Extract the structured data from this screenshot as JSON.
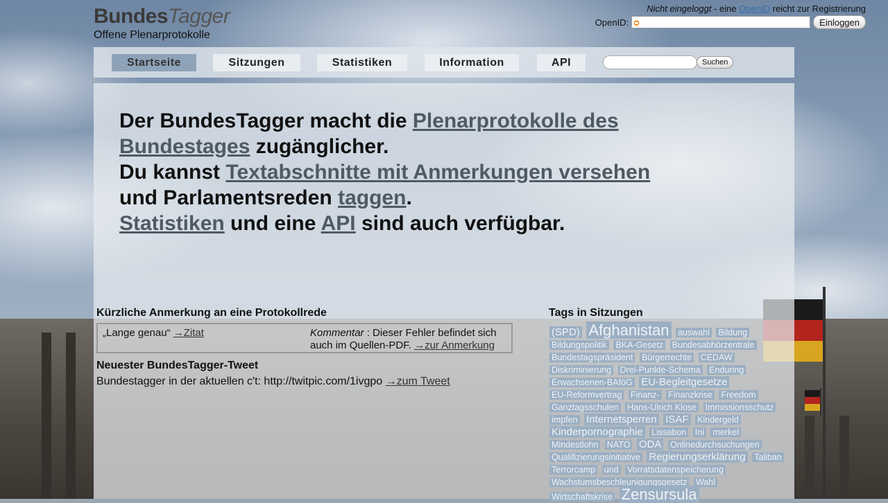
{
  "header": {
    "brand_bold": "Bundes",
    "brand_italic": "Tagger",
    "brand_subtitle": "Offene Plenarprotokolle",
    "login_status_italic": "Nicht eingeloggt",
    "login_status_mid": " - eine ",
    "login_openid_link": "OpenID",
    "login_status_end": " reicht zur Registrierung",
    "openid_label": "OpenID:",
    "openid_value": "",
    "login_button": "Einloggen"
  },
  "nav": {
    "tabs": [
      {
        "label": "Startseite",
        "active": true
      },
      {
        "label": "Sitzungen",
        "active": false
      },
      {
        "label": "Statistiken",
        "active": false
      },
      {
        "label": "Information",
        "active": false
      },
      {
        "label": "API",
        "active": false
      }
    ],
    "search_value": "",
    "search_button": "Suchen"
  },
  "intro": {
    "p1": "Der BundesTagger macht die ",
    "link1": "Plenarprotokolle des Bundestages",
    "p2": " zugänglicher.",
    "p3": "Du kannst ",
    "link2": "Textabschnitte mit Anmerkungen versehen",
    "p4": " und Parlamentsreden ",
    "link3": "taggen",
    "p5": ".",
    "link4": "Statistiken",
    "p6": " und eine ",
    "link5": "API",
    "p7": " sind auch verfügbar."
  },
  "annotation": {
    "heading": "Kürzliche Anmerkung an eine Protokollrede",
    "quote": "„Lange genau“ ",
    "quote_link": "→Zitat",
    "comment_label": "Kommentar",
    "comment_text": " : Dieser Fehler befindet sich auch im Quellen-PDF. ",
    "comment_link": "→zur Anmerkung"
  },
  "tweet": {
    "heading": "Neuester BundesTagger-Tweet",
    "text": "Bundestagger in der aktuellen c't: http://twitpic.com/1ivgpo ",
    "link": "→zum Tweet"
  },
  "tags": {
    "heading": "Tags in Sitzungen",
    "items": [
      {
        "label": "(SPD)",
        "size": "l"
      },
      {
        "label": "Afghanistan",
        "size": "xl"
      },
      {
        "label": "auswahl",
        "size": "s"
      },
      {
        "label": "Bildung",
        "size": "s"
      },
      {
        "label": "Bildungspolitik",
        "size": "s"
      },
      {
        "label": "BKA-Gesetz",
        "size": "s"
      },
      {
        "label": "Bundesabhörzentrale",
        "size": "s"
      },
      {
        "label": "Bundestagspräsident",
        "size": "s"
      },
      {
        "label": "Bürgerrechte",
        "size": "s"
      },
      {
        "label": "CEDAW",
        "size": "s"
      },
      {
        "label": "Diskriminierung",
        "size": "s"
      },
      {
        "label": "Drei-Punkte-Schema",
        "size": "s"
      },
      {
        "label": "Enduring",
        "size": "s"
      },
      {
        "label": "Erwachsenen-BAföG",
        "size": "s"
      },
      {
        "label": "EU-Begleitgesetze",
        "size": "l"
      },
      {
        "label": "EU-Reformvertrag",
        "size": "s"
      },
      {
        "label": "Finanz-",
        "size": "s"
      },
      {
        "label": "Finanzkrise",
        "size": "s"
      },
      {
        "label": "Freedom",
        "size": "s"
      },
      {
        "label": "Ganztagsschulen",
        "size": "s"
      },
      {
        "label": "Hans-Ulrich Klose",
        "size": "s"
      },
      {
        "label": "Immissionsschutz",
        "size": "s"
      },
      {
        "label": "impfen",
        "size": "s"
      },
      {
        "label": "Internetsperren",
        "size": "l"
      },
      {
        "label": "ISAF",
        "size": "l"
      },
      {
        "label": "Kindergeld",
        "size": "s"
      },
      {
        "label": "Kinderpornographie",
        "size": "l"
      },
      {
        "label": "Lissabon",
        "size": "s"
      },
      {
        "label": "Ini",
        "size": "s"
      },
      {
        "label": "merkel",
        "size": "s"
      },
      {
        "label": "Mindestlohn",
        "size": "s"
      },
      {
        "label": "NATO",
        "size": "s"
      },
      {
        "label": "ODA",
        "size": "l"
      },
      {
        "label": "Onlinedurchsuchungen",
        "size": "s"
      },
      {
        "label": "Qualifizierungsinitiative",
        "size": "s"
      },
      {
        "label": "Regierungserklärung",
        "size": "l"
      },
      {
        "label": "Taliban",
        "size": "s"
      },
      {
        "label": "Terrorcamp",
        "size": "s"
      },
      {
        "label": "und",
        "size": "s"
      },
      {
        "label": "Vorratsdatenspeicherung",
        "size": "s"
      },
      {
        "label": "Wachstumsbeschleunigungsgesetz",
        "size": "s"
      },
      {
        "label": "Wahl",
        "size": "s"
      },
      {
        "label": "Wirtschaftskrise",
        "size": "s"
      },
      {
        "label": "Zensursula",
        "size": "xl"
      }
    ]
  }
}
